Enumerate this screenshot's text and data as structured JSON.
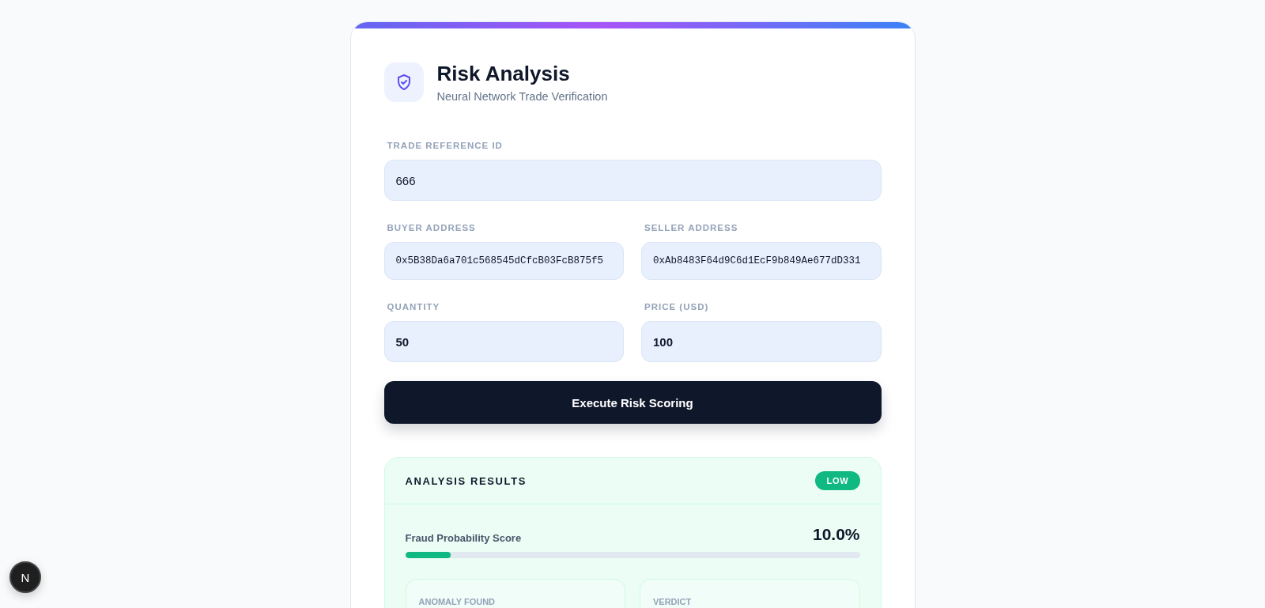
{
  "header": {
    "title": "Risk Analysis",
    "subtitle": "Neural Network Trade Verification"
  },
  "fields": [
    {
      "label": "TRADE REFERENCE ID",
      "value": "666",
      "kind": "text",
      "wide": true
    },
    {
      "label": "BUYER ADDRESS",
      "value": "0x5B38Da6a701c568545dCfcB03FcB875f5",
      "kind": "address",
      "wide": false
    },
    {
      "label": "SELLER ADDRESS",
      "value": "0xAb8483F64d9C6d1EcF9b849Ae677dD331",
      "kind": "address",
      "wide": false
    },
    {
      "label": "QUANTITY",
      "value": "50",
      "kind": "number",
      "wide": false
    },
    {
      "label": "PRICE (USD)",
      "value": "100",
      "kind": "number",
      "wide": false
    }
  ],
  "submit_button": "Execute Risk Scoring",
  "results": {
    "title": "ANALYSIS RESULTS",
    "risk_badge": "LOW",
    "score_label": "Fraud Probability Score",
    "score_value": "10.0%",
    "level": 0.1,
    "details": [
      {
        "label": "ANOMALY FOUND"
      },
      {
        "label": "VERDICT"
      }
    ]
  },
  "dev_badge": "N"
}
